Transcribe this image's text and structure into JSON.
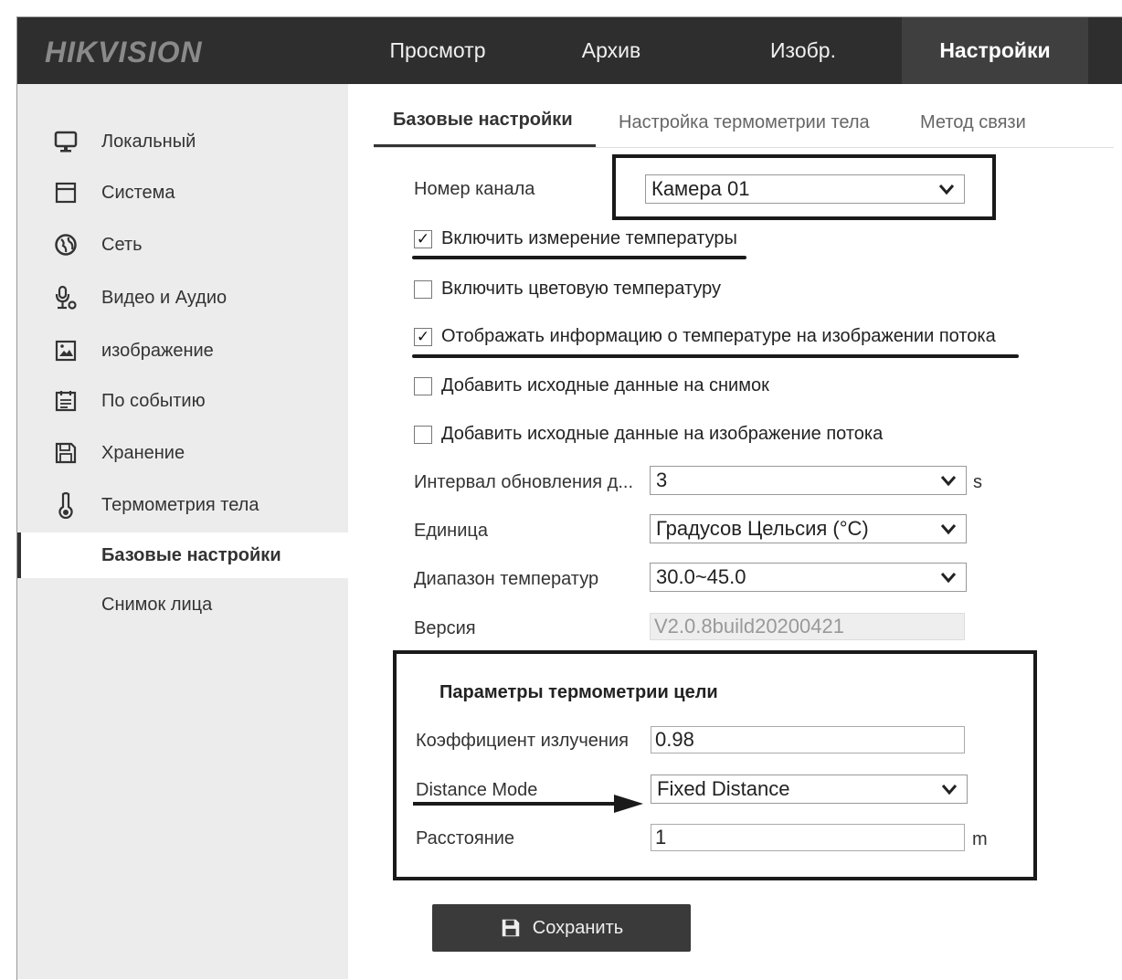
{
  "header": {
    "logo": "HIKVISION",
    "nav": [
      "Просмотр",
      "Архив",
      "Изобр.",
      "Настройки"
    ]
  },
  "sidebar": {
    "items": [
      {
        "label": "Локальный",
        "icon": "monitor-icon"
      },
      {
        "label": "Система",
        "icon": "window-icon"
      },
      {
        "label": "Сеть",
        "icon": "globe-icon"
      },
      {
        "label": "Видео и Аудио",
        "icon": "microphone-icon"
      },
      {
        "label": "изображение",
        "icon": "image-icon"
      },
      {
        "label": "По событию",
        "icon": "calendar-icon"
      },
      {
        "label": "Хранение",
        "icon": "floppy-icon"
      },
      {
        "label": "Термометрия тела",
        "icon": "thermometer-icon"
      }
    ],
    "sub_items": [
      "Базовые настройки",
      "Снимок лица"
    ]
  },
  "tabs": [
    "Базовые настройки",
    "Настройка термометрии тела",
    "Метод связи"
  ],
  "form": {
    "channel_label": "Номер канала",
    "channel_value": "Камера 01",
    "checkboxes": [
      {
        "label": "Включить измерение температуры",
        "checked": true
      },
      {
        "label": "Включить цветовую температуру",
        "checked": false
      },
      {
        "label": "Отображать информацию о температуре на изображении потока",
        "checked": true
      },
      {
        "label": "Добавить исходные данные на снимок",
        "checked": false
      },
      {
        "label": "Добавить исходные данные на изображение потока",
        "checked": false
      }
    ],
    "interval_label": "Интервал обновления д...",
    "interval_value": "3",
    "interval_unit": "s",
    "unit_label": "Единица",
    "unit_value": "Градусов Цельсия (°C)",
    "range_label": "Диапазон температур",
    "range_value": "30.0~45.0",
    "version_label": "Версия",
    "version_value": "V2.0.8build20200421",
    "target_section_title": "Параметры термометрии цели",
    "emissivity_label": "Коэффициент излучения",
    "emissivity_value": "0.98",
    "distance_mode_label": "Distance Mode",
    "distance_mode_value": "Fixed Distance",
    "distance_label": "Расстояние",
    "distance_value": "1",
    "distance_unit": "m",
    "save_label": "Сохранить",
    "checkmark": "✓"
  },
  "colors": {
    "topbar": "#2e2e2e",
    "sidebar": "#ececec",
    "accent": "#1a1a1a"
  }
}
